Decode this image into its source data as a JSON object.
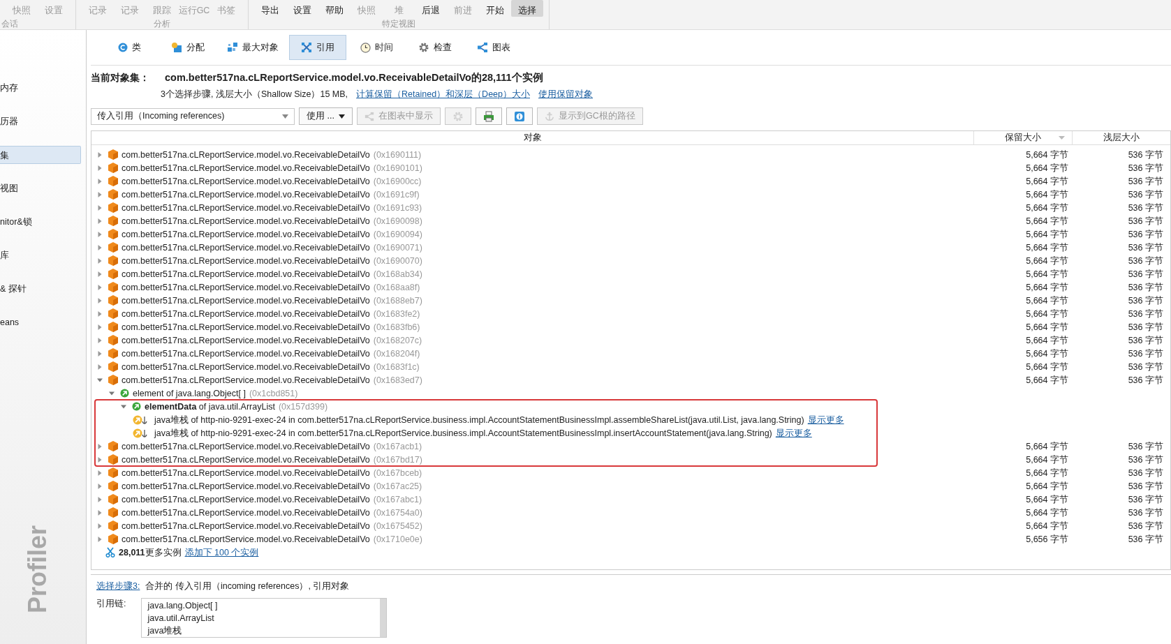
{
  "toolbar": {
    "groups": [
      {
        "label": "会话",
        "buttons": [
          {
            "label": "快照",
            "disabled": true,
            "selected": false
          },
          {
            "label": "设置",
            "disabled": true,
            "selected": false
          }
        ]
      },
      {
        "label": "分析",
        "buttons": [
          {
            "label": "记录",
            "disabled": true,
            "selected": false
          },
          {
            "label": "记录",
            "disabled": true,
            "selected": false
          },
          {
            "label": "跟踪",
            "disabled": true,
            "selected": false
          },
          {
            "label": "运行GC",
            "disabled": true,
            "selected": false
          },
          {
            "label": "书签",
            "disabled": true,
            "selected": false
          }
        ]
      },
      {
        "label": "特定视图",
        "buttons": [
          {
            "label": "导出",
            "disabled": false,
            "selected": false
          },
          {
            "label": "设置",
            "disabled": false,
            "selected": false
          },
          {
            "label": "帮助",
            "disabled": false,
            "selected": false
          },
          {
            "label": "快照",
            "disabled": true,
            "selected": false
          },
          {
            "label": "堆",
            "disabled": true,
            "selected": false
          },
          {
            "label": "后退",
            "disabled": false,
            "selected": false
          },
          {
            "label": "前进",
            "disabled": true,
            "selected": false
          },
          {
            "label": "开始",
            "disabled": false,
            "selected": false
          },
          {
            "label": "选择",
            "disabled": false,
            "selected": true
          }
        ]
      }
    ]
  },
  "sidebar": {
    "items": [
      {
        "label": "内存",
        "selected": false
      },
      {
        "label": "历器",
        "selected": false
      },
      {
        "label": "集",
        "selected": true
      },
      {
        "label": "视图",
        "selected": false
      },
      {
        "label": "nitor&锁",
        "selected": false
      },
      {
        "label": "库",
        "selected": false
      },
      {
        "label": "& 探针",
        "selected": false
      },
      {
        "label": "eans",
        "selected": false
      }
    ],
    "brand": "Profiler"
  },
  "tabs": [
    {
      "label": "类",
      "selected": false
    },
    {
      "label": "分配",
      "selected": false
    },
    {
      "label": "最大对象",
      "selected": false
    },
    {
      "label": "引用",
      "selected": true
    },
    {
      "label": "时间",
      "selected": false
    },
    {
      "label": "检查",
      "selected": false
    },
    {
      "label": "图表",
      "selected": false
    }
  ],
  "object_set": {
    "label": "当前对象集：",
    "title": "com.better517na.cLReportService.model.vo.ReceivableDetailVo的28,111个实例",
    "summary": "3个选择步骤, 浅层大小（Shallow Size）15 MB,",
    "links": [
      "计算保留（Retained）和深层（Deep）大小",
      "使用保留对象"
    ]
  },
  "controls": {
    "dropdown": {
      "value": "传入引用（Incoming references)"
    },
    "buttons": [
      {
        "kind": "menu",
        "label": "使用 ...",
        "disabled": false
      },
      {
        "kind": "graph",
        "label": "在图表中显示",
        "disabled": true
      },
      {
        "kind": "gear",
        "disabled": true
      },
      {
        "kind": "print",
        "disabled": false
      },
      {
        "kind": "info",
        "disabled": false
      },
      {
        "kind": "anchor",
        "label": "显示到GC根的路径",
        "disabled": true
      }
    ]
  },
  "table": {
    "columns": [
      {
        "label": "对象",
        "sorted": false
      },
      {
        "label": "保留大小",
        "sorted": true
      },
      {
        "label": "浅层大小",
        "sorted": false
      }
    ],
    "rows": [
      {
        "kind": "instance",
        "name": "com.better517na.cLReportService.model.vo.ReceivableDetailVo",
        "address": "(0x1690111)",
        "retained": "5,664 字节",
        "shallow": "536 字节",
        "expanded": false
      },
      {
        "kind": "instance",
        "name": "com.better517na.cLReportService.model.vo.ReceivableDetailVo",
        "address": "(0x1690101)",
        "retained": "5,664 字节",
        "shallow": "536 字节",
        "expanded": false
      },
      {
        "kind": "instance",
        "name": "com.better517na.cLReportService.model.vo.ReceivableDetailVo",
        "address": "(0x16900cc)",
        "retained": "5,664 字节",
        "shallow": "536 字节",
        "expanded": false
      },
      {
        "kind": "instance",
        "name": "com.better517na.cLReportService.model.vo.ReceivableDetailVo",
        "address": "(0x1691c9f)",
        "retained": "5,664 字节",
        "shallow": "536 字节",
        "expanded": false
      },
      {
        "kind": "instance",
        "name": "com.better517na.cLReportService.model.vo.ReceivableDetailVo",
        "address": "(0x1691c93)",
        "retained": "5,664 字节",
        "shallow": "536 字节",
        "expanded": false
      },
      {
        "kind": "instance",
        "name": "com.better517na.cLReportService.model.vo.ReceivableDetailVo",
        "address": "(0x1690098)",
        "retained": "5,664 字节",
        "shallow": "536 字节",
        "expanded": false
      },
      {
        "kind": "instance",
        "name": "com.better517na.cLReportService.model.vo.ReceivableDetailVo",
        "address": "(0x1690094)",
        "retained": "5,664 字节",
        "shallow": "536 字节",
        "expanded": false
      },
      {
        "kind": "instance",
        "name": "com.better517na.cLReportService.model.vo.ReceivableDetailVo",
        "address": "(0x1690071)",
        "retained": "5,664 字节",
        "shallow": "536 字节",
        "expanded": false
      },
      {
        "kind": "instance",
        "name": "com.better517na.cLReportService.model.vo.ReceivableDetailVo",
        "address": "(0x1690070)",
        "retained": "5,664 字节",
        "shallow": "536 字节",
        "expanded": false
      },
      {
        "kind": "instance",
        "name": "com.better517na.cLReportService.model.vo.ReceivableDetailVo",
        "address": "(0x168ab34)",
        "retained": "5,664 字节",
        "shallow": "536 字节",
        "expanded": false
      },
      {
        "kind": "instance",
        "name": "com.better517na.cLReportService.model.vo.ReceivableDetailVo",
        "address": "(0x168aa8f)",
        "retained": "5,664 字节",
        "shallow": "536 字节",
        "expanded": false
      },
      {
        "kind": "instance",
        "name": "com.better517na.cLReportService.model.vo.ReceivableDetailVo",
        "address": "(0x1688eb7)",
        "retained": "5,664 字节",
        "shallow": "536 字节",
        "expanded": false
      },
      {
        "kind": "instance",
        "name": "com.better517na.cLReportService.model.vo.ReceivableDetailVo",
        "address": "(0x1683fe2)",
        "retained": "5,664 字节",
        "shallow": "536 字节",
        "expanded": false
      },
      {
        "kind": "instance",
        "name": "com.better517na.cLReportService.model.vo.ReceivableDetailVo",
        "address": "(0x1683fb6)",
        "retained": "5,664 字节",
        "shallow": "536 字节",
        "expanded": false
      },
      {
        "kind": "instance",
        "name": "com.better517na.cLReportService.model.vo.ReceivableDetailVo",
        "address": "(0x168207c)",
        "retained": "5,664 字节",
        "shallow": "536 字节",
        "expanded": false
      },
      {
        "kind": "instance",
        "name": "com.better517na.cLReportService.model.vo.ReceivableDetailVo",
        "address": "(0x168204f)",
        "retained": "5,664 字节",
        "shallow": "536 字节",
        "expanded": false
      },
      {
        "kind": "instance",
        "name": "com.better517na.cLReportService.model.vo.ReceivableDetailVo",
        "address": "(0x1683f1c)",
        "retained": "5,664 字节",
        "shallow": "536 字节",
        "expanded": false
      },
      {
        "kind": "instance",
        "name": "com.better517na.cLReportService.model.vo.ReceivableDetailVo",
        "address": "(0x1683ed7)",
        "retained": "5,664 字节",
        "shallow": "536 字节",
        "expanded": true,
        "children": [
          {
            "kind": "reference",
            "name": "element of java.lang.Object[ ]",
            "address": "(0x1cbd851)",
            "expanded": true,
            "children": [
              {
                "kind": "reference",
                "name": "**elementData** of java.util.ArrayList",
                "address": "(0x157d399)",
                "expanded": true,
                "children": [
                  {
                    "kind": "stack",
                    "name": "java堆栈 of http-nio-9291-exec-24 in com.better517na.cLReportService.business.impl.AccountStatementBusinessImpl.assembleShareList(java.util.List, java.lang.String)",
                    "link": "显示更多"
                  },
                  {
                    "kind": "stack",
                    "name": "java堆栈 of http-nio-9291-exec-24 in com.better517na.cLReportService.business.impl.AccountStatementBusinessImpl.insertAccountStatement(java.lang.String)",
                    "link": "显示更多"
                  }
                ]
              }
            ]
          }
        ]
      },
      {
        "kind": "instance",
        "name": "com.better517na.cLReportService.model.vo.ReceivableDetailVo",
        "address": "(0x167acb1)",
        "retained": "5,664 字节",
        "shallow": "536 字节",
        "expanded": false
      },
      {
        "kind": "instance",
        "name": "com.better517na.cLReportService.model.vo.ReceivableDetailVo",
        "address": "(0x167bd17)",
        "retained": "5,664 字节",
        "shallow": "536 字节",
        "expanded": false
      },
      {
        "kind": "instance",
        "name": "com.better517na.cLReportService.model.vo.ReceivableDetailVo",
        "address": "(0x167bceb)",
        "retained": "5,664 字节",
        "shallow": "536 字节",
        "expanded": false
      },
      {
        "kind": "instance",
        "name": "com.better517na.cLReportService.model.vo.ReceivableDetailVo",
        "address": "(0x167ac25)",
        "retained": "5,664 字节",
        "shallow": "536 字节",
        "expanded": false
      },
      {
        "kind": "instance",
        "name": "com.better517na.cLReportService.model.vo.ReceivableDetailVo",
        "address": "(0x167abc1)",
        "retained": "5,664 字节",
        "shallow": "536 字节",
        "expanded": false
      },
      {
        "kind": "instance",
        "name": "com.better517na.cLReportService.model.vo.ReceivableDetailVo",
        "address": "(0x16754a0)",
        "retained": "5,664 字节",
        "shallow": "536 字节",
        "expanded": false
      },
      {
        "kind": "instance",
        "name": "com.better517na.cLReportService.model.vo.ReceivableDetailVo",
        "address": "(0x1675452)",
        "retained": "5,664 字节",
        "shallow": "536 字节",
        "expanded": false
      },
      {
        "kind": "instance",
        "name": "com.better517na.cLReportService.model.vo.ReceivableDetailVo",
        "address": "(0x1710e0e)",
        "retained": "5,656 字节",
        "shallow": "536 字节",
        "expanded": false
      }
    ],
    "more": {
      "text": "**28,011**更多实例",
      "link": "添加下 100 个实例"
    }
  },
  "selection_step": {
    "link": "选择步骤3:",
    "text": "合并的 传入引用（incoming references）, 引用对象"
  },
  "reference_chain": {
    "label": "引用链:",
    "items": [
      "java.lang.Object[ ]",
      "java.util.ArrayList",
      "java堆栈"
    ]
  }
}
